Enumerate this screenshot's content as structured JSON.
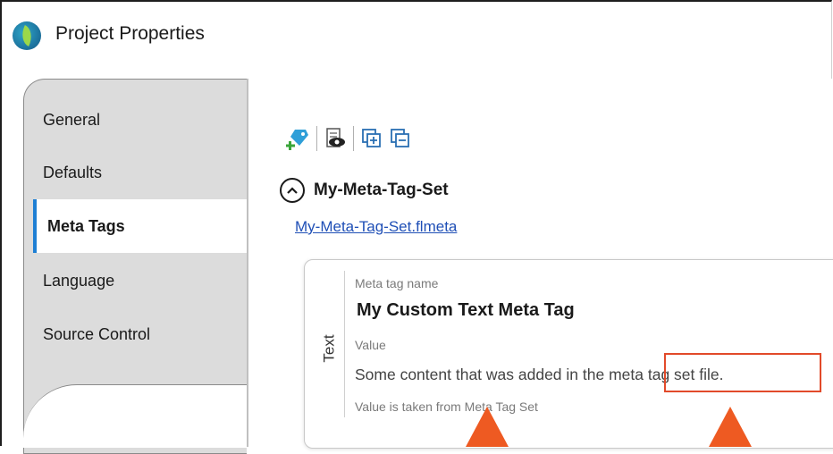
{
  "window": {
    "title": "Project Properties",
    "icon": "flare-leaf-icon"
  },
  "sidebar": {
    "items": [
      {
        "label": "General",
        "active": false
      },
      {
        "label": "Defaults",
        "active": false
      },
      {
        "label": "Meta Tags",
        "active": true
      },
      {
        "label": "Language",
        "active": false
      },
      {
        "label": "Source Control",
        "active": false
      }
    ]
  },
  "toolbar": {
    "buttons": [
      "add-meta-tag-set-icon",
      "preview-icon",
      "expand-all-icon",
      "collapse-all-icon"
    ]
  },
  "meta_tag_set": {
    "name": "My-Meta-Tag-Set",
    "file_link": "My-Meta-Tag-Set.flmeta",
    "card": {
      "type_label": "Text",
      "name_label": "Meta tag name",
      "name_value": "My Custom Text Meta Tag",
      "value_label": "Value",
      "value_text_before": "Some content that was added in the ",
      "value_text_highlight": "meta tag set file.",
      "note": "Value is taken from Meta Tag Set"
    }
  },
  "colors": {
    "accent": "#1e7fd4",
    "highlight": "#e24a2a",
    "arrow": "#ee5a22",
    "link": "#1f4fb6"
  }
}
